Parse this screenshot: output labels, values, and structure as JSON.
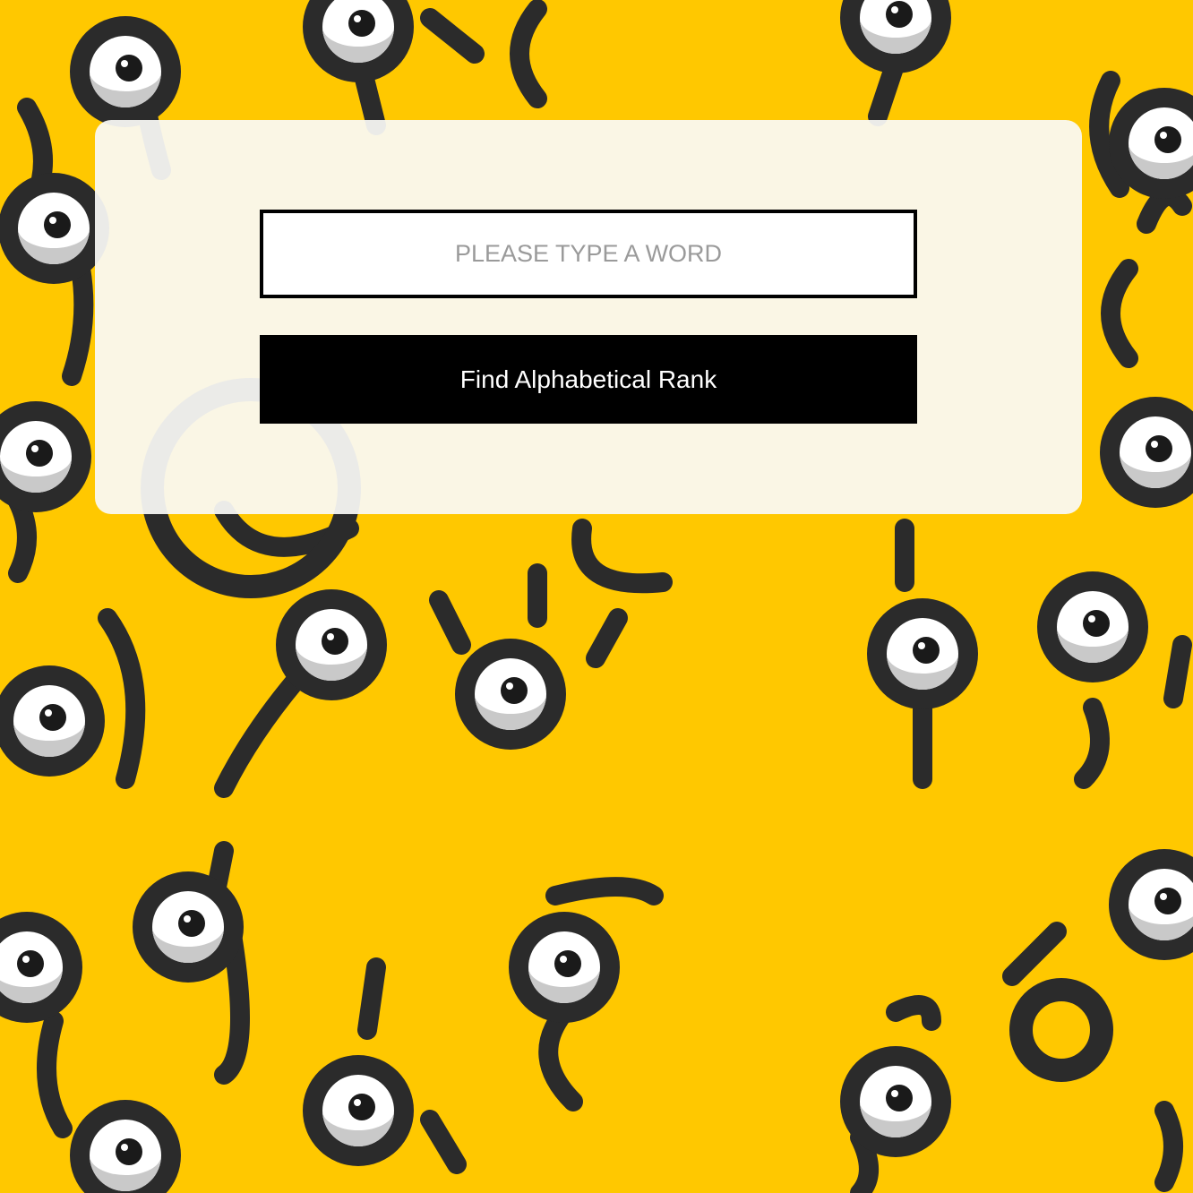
{
  "background": {
    "color": "#FFC800",
    "pattern": "unown-characters",
    "glyph_color": "#2b2b2b",
    "eye_color": "#ffffff"
  },
  "card": {
    "background": "#FAFAF6"
  },
  "form": {
    "input_placeholder": "PLEASE TYPE A WORD",
    "input_value": "",
    "button_label": "Find Alphabetical Rank"
  }
}
